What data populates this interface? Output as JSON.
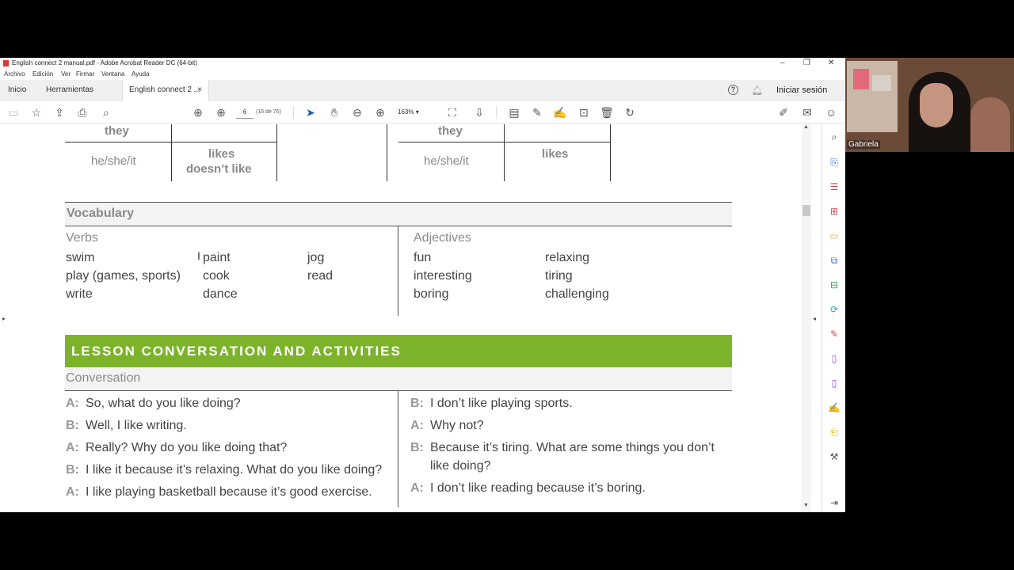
{
  "window": {
    "title": "English connect 2 manual.pdf - Adobe Acrobat Reader DC (64-bit)",
    "controls": {
      "minimize": "–",
      "maximize": "❐",
      "close": "✕"
    }
  },
  "menu": [
    "Archivo",
    "Edición",
    "Ver",
    "Firmar",
    "Ventana",
    "Ayuda"
  ],
  "tabs": {
    "home": "Inicio",
    "tools": "Herramientas",
    "document": "English connect 2 ...",
    "close": "×",
    "help": "?",
    "signin": "Iniciar sesión"
  },
  "toolbar": {
    "page_current": "6",
    "page_count": "(16 de 76)",
    "zoom": "163%"
  },
  "document": {
    "left_table": {
      "row1": "they",
      "row2_subject": "he/she/it",
      "row2_line1": "likes",
      "row2_line2": "doesn’t like"
    },
    "right_table": {
      "row1": "they",
      "row2_subject": "he/she/it",
      "row2_value": "likes"
    },
    "vocabulary": {
      "heading": "Vocabulary",
      "verbs_heading": "Verbs",
      "verbs_col1": [
        "swim",
        "play (games, sports)",
        "write"
      ],
      "verbs_col2": [
        "paint",
        "cook",
        "dance"
      ],
      "verbs_col3": [
        "jog",
        "read"
      ],
      "adjectives_heading": "Adjectives",
      "adj_col1": [
        "fun",
        "interesting",
        "boring"
      ],
      "adj_col2": [
        "relaxing",
        "tiring",
        "challenging"
      ]
    },
    "lesson_banner": "LESSON CONVERSATION AND ACTIVITIES",
    "banner_color": "#7cb32b",
    "conversation": {
      "heading": "Conversation",
      "left": [
        {
          "speaker": "A:",
          "line": "So, what do you like doing?"
        },
        {
          "speaker": "B:",
          "line": "Well, I like writing."
        },
        {
          "speaker": "A:",
          "line": "Really? Why do you like doing that?"
        },
        {
          "speaker": "B:",
          "line": "I like it because it’s relaxing. What do you like doing?"
        },
        {
          "speaker": "A:",
          "line": "I like playing basketball because it’s good exercise."
        }
      ],
      "right": [
        {
          "speaker": "B:",
          "line": "I don’t like playing sports."
        },
        {
          "speaker": "A:",
          "line": "Why not?"
        },
        {
          "speaker": "B:",
          "line": "Because it’s tiring. What are some things you don’t",
          "line2": "like doing?"
        },
        {
          "speaker": "A:",
          "line": "I don’t like reading because it’s boring."
        }
      ]
    }
  },
  "webcam": {
    "participant_name": "Gabriela"
  }
}
